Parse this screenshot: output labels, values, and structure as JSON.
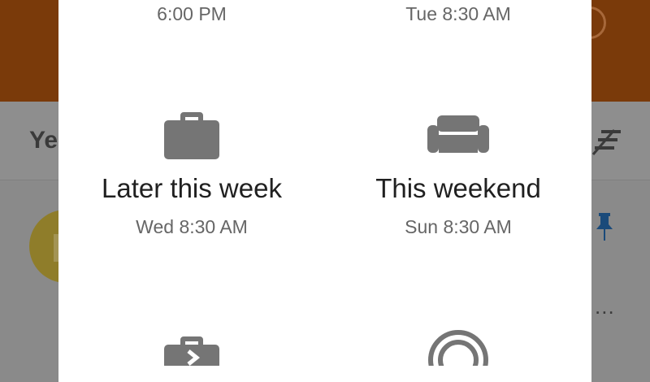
{
  "background": {
    "toolbar_label": "Ye",
    "overflow_text": "..."
  },
  "dialog": {
    "options": [
      {
        "id": "later-today",
        "title": "",
        "time": "6:00 PM",
        "icon": "clock-icon"
      },
      {
        "id": "tomorrow",
        "title": "",
        "time": "Tue 8:30 AM",
        "icon": "sun-icon"
      },
      {
        "id": "later-this-week",
        "title": "Later this week",
        "time": "Wed 8:30 AM",
        "icon": "briefcase-icon"
      },
      {
        "id": "this-weekend",
        "title": "This weekend",
        "time": "Sun 8:30 AM",
        "icon": "sofa-icon"
      },
      {
        "id": "next-week",
        "title": "",
        "time": "",
        "icon": "briefcase-arrow-icon"
      },
      {
        "id": "someday",
        "title": "",
        "time": "",
        "icon": "target-icon"
      }
    ]
  },
  "colors": {
    "header": "#7a3a0a",
    "icon_gray": "#757575",
    "pin_blue": "#1a4a7a",
    "avatar": "#8f7d2a"
  }
}
